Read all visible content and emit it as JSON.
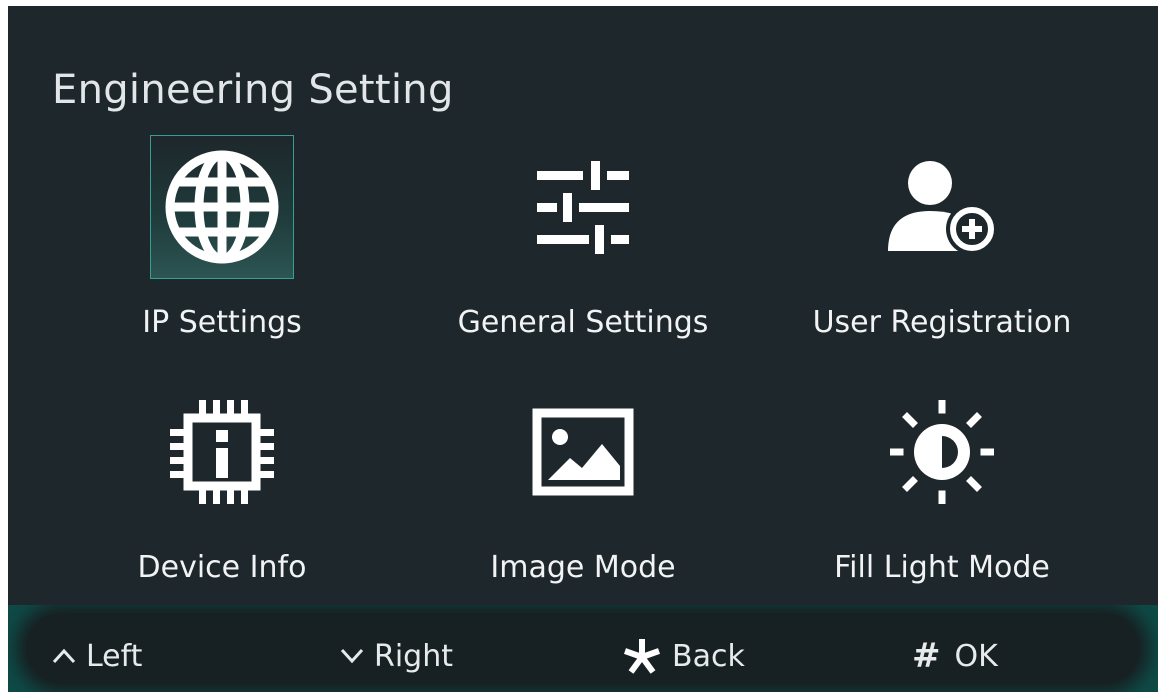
{
  "header": {
    "title": "Engineering Setting"
  },
  "menu": {
    "items": [
      {
        "label": "IP Settings",
        "icon": "globe-icon",
        "selected": true
      },
      {
        "label": "General Settings",
        "icon": "sliders-icon",
        "selected": false
      },
      {
        "label": "User Registration",
        "icon": "user-add-icon",
        "selected": false
      },
      {
        "label": "Device Info",
        "icon": "chip-info-icon",
        "selected": false
      },
      {
        "label": "Image Mode",
        "icon": "image-icon",
        "selected": false
      },
      {
        "label": "Fill Light Mode",
        "icon": "brightness-icon",
        "selected": false
      }
    ]
  },
  "footer": {
    "hints": [
      {
        "key_icon": "caret-up-icon",
        "label": "Left"
      },
      {
        "key_icon": "caret-down-icon",
        "label": "Right"
      },
      {
        "key_icon": "asterisk-icon",
        "label": "Back"
      },
      {
        "key": "#",
        "label": "OK"
      }
    ]
  },
  "colors": {
    "background": "#1e272b",
    "accent": "#33a18d",
    "footer_glow": "#0e4a46",
    "text": "#f1f3f4"
  }
}
